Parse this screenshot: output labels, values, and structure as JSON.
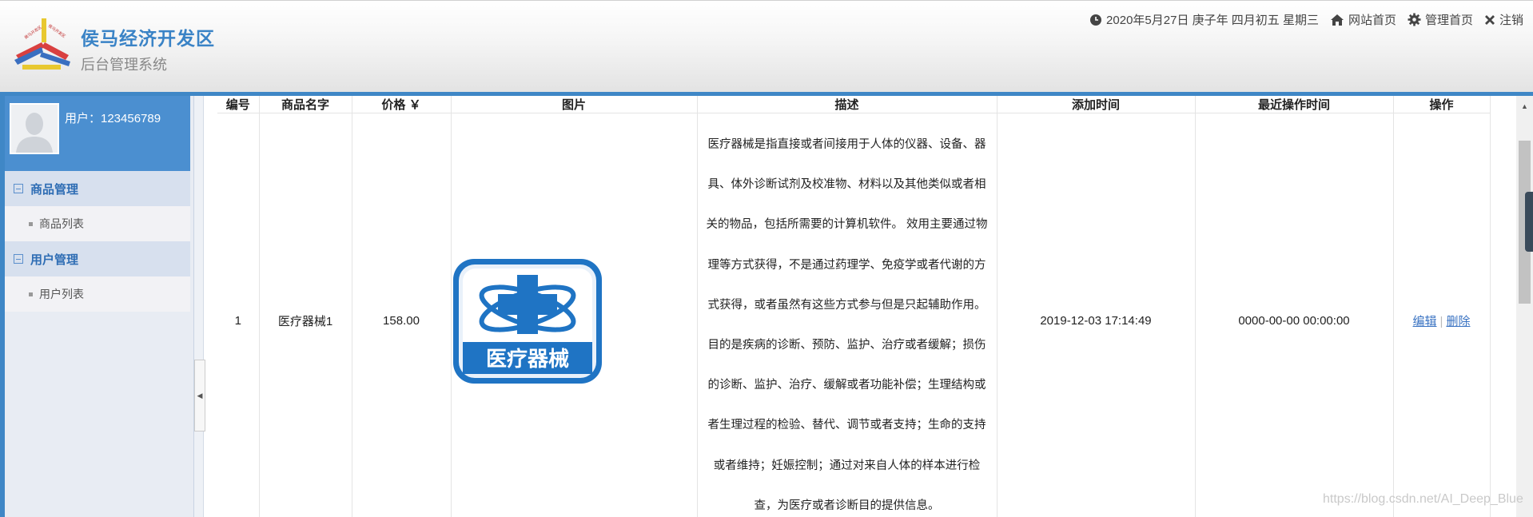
{
  "header": {
    "title": "侯马经济开发区",
    "subtitle": "后台管理系统",
    "date": "2020年5月27日 庚子年 四月初五 星期三",
    "links": {
      "site_home": "网站首页",
      "admin_home": "管理首页",
      "logout": "注销"
    }
  },
  "sidebar": {
    "user_label": "用户：123456789",
    "groups": [
      {
        "label": "商品管理",
        "items": [
          "商品列表"
        ]
      },
      {
        "label": "用户管理",
        "items": [
          "用户列表"
        ]
      }
    ]
  },
  "table": {
    "headers": [
      "编号",
      "商品名字",
      "价格 ￥",
      "图片",
      "描述",
      "添加时间",
      "最近操作时间",
      "操作"
    ],
    "rows": [
      {
        "id": "1",
        "name": "医疗器械1",
        "price": "158.00",
        "image_text": "医疗器械",
        "description_lines": [
          "医疗器械是指直接或者间接用于人体的仪器、设备、器",
          "具、体外诊断试剂及校准物、材料以及其他类似或者相",
          "关的物品，包括所需要的计算机软件。 效用主要通过物",
          "理等方式获得，不是通过药理学、免疫学或者代谢的方",
          "式获得，或者虽然有这些方式参与但是只起辅助作用。",
          "目的是疾病的诊断、预防、监护、治疗或者缓解；损伤",
          "的诊断、监护、治疗、缓解或者功能补偿；生理结构或",
          "者生理过程的检验、替代、调节或者支持；生命的支持",
          "或者维持；妊娠控制；通过对来自人体的样本进行检",
          "查，为医疗或者诊断目的提供信息。"
        ],
        "created": "2019-12-03 17:14:49",
        "updated": "0000-00-00 00:00:00",
        "edit": "编辑",
        "delete": "删除",
        "sep": "|"
      }
    ]
  },
  "watermark": "https://blog.csdn.net/AI_Deep_Blue",
  "colors": {
    "accent": "#3f87c6",
    "title": "#3a83c6",
    "link": "#3a73c2"
  }
}
